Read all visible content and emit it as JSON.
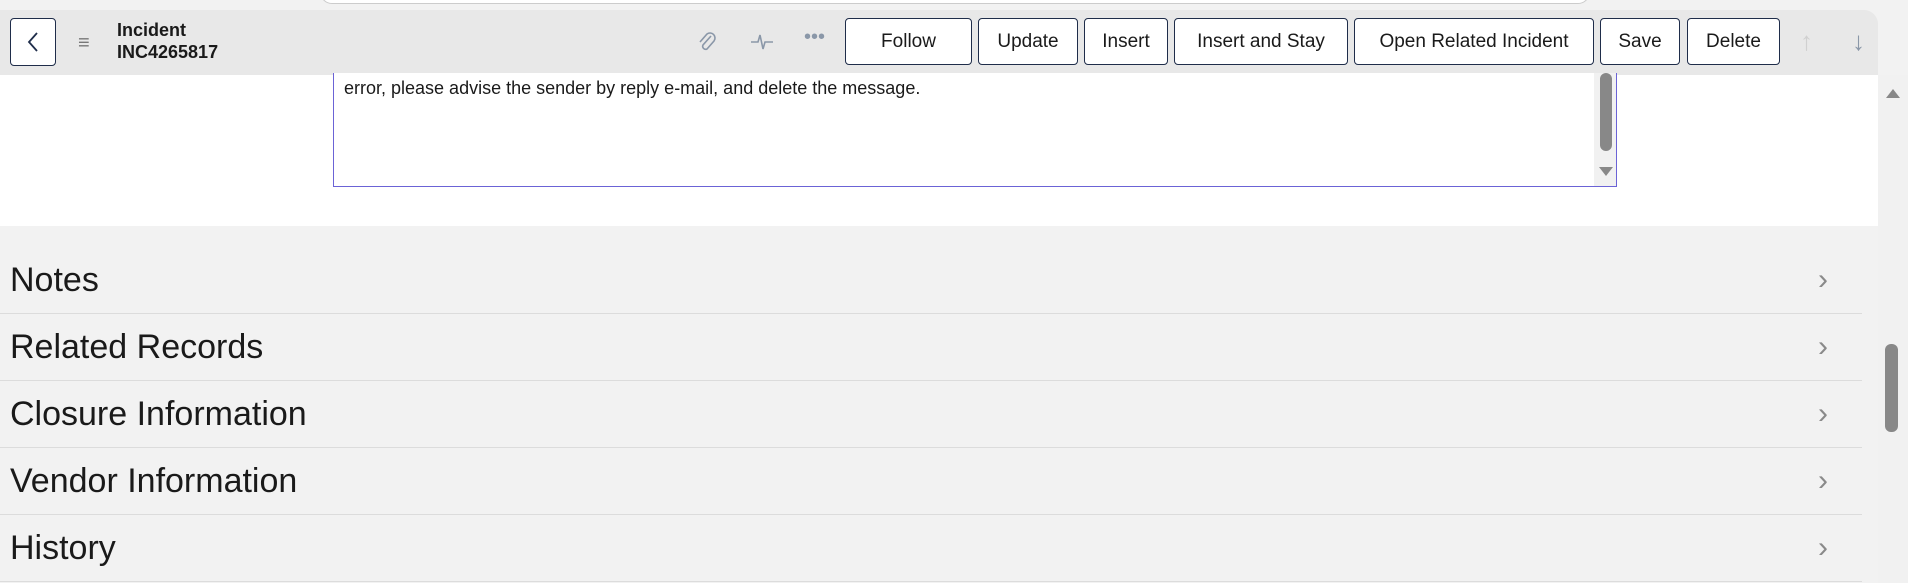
{
  "header": {
    "title": "Incident",
    "number": "INC4265817"
  },
  "toolbar": {
    "buttons": [
      "Follow",
      "Update",
      "Insert",
      "Insert and Stay",
      "Open Related Incident",
      "Save",
      "Delete"
    ]
  },
  "description": {
    "text": "error, please advise the sender by reply e-mail, and delete the message."
  },
  "sections": [
    "Notes",
    "Related Records",
    "Closure Information",
    "Vendor Information",
    "History"
  ]
}
